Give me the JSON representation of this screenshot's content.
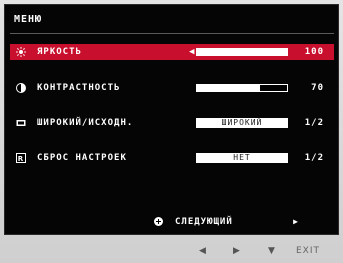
{
  "menu": {
    "title": "МЕНЮ"
  },
  "rows": [
    {
      "label": "ЯРКОСТЬ",
      "icon": "sun-icon",
      "type": "slider",
      "value": "100",
      "fraction": 1.0,
      "arrow": "◀",
      "selected": true
    },
    {
      "label": "КОНТРАСТНОСТЬ",
      "icon": "contrast-icon",
      "type": "slider",
      "value": "70",
      "fraction": 0.7,
      "selected": false
    },
    {
      "label": "ШИРОКИЙ/ИСХОДН.",
      "icon": "aspect-ratio-icon",
      "type": "option",
      "option": "ШИРОКИЙ",
      "value": "1/2",
      "selected": false
    },
    {
      "label": "СБРОС НАСТРОЕК",
      "icon": "reset-icon",
      "type": "option",
      "option": "НЕТ",
      "value": "1/2",
      "selected": false
    }
  ],
  "next_button": {
    "label": "СЛЕДУЮЩИЙ",
    "arrow": "▶",
    "icon": "plus-circle-icon"
  },
  "nav": {
    "left": "◀",
    "right": "▶",
    "down": "▼",
    "exit": "EXIT"
  },
  "colors": {
    "accent": "#c8102e",
    "screen_bg": "#050505",
    "bezel": "#d8d8d8"
  }
}
